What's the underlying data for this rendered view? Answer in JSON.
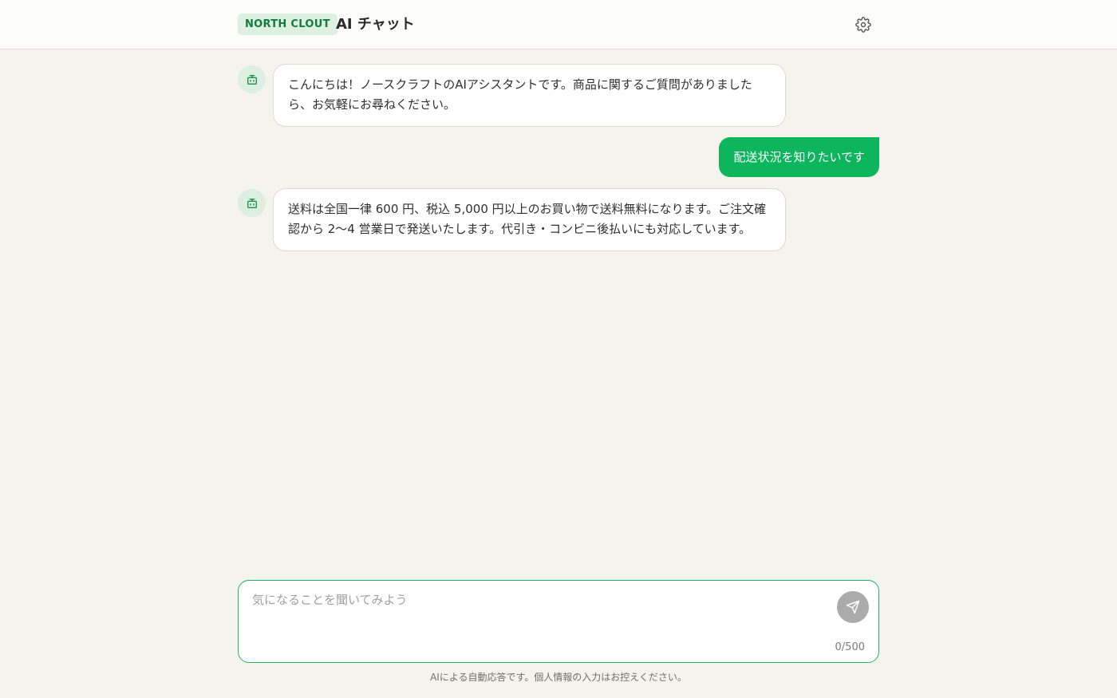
{
  "header": {
    "brand": "NORTH CLOUT",
    "title": "AI チャット",
    "settings_icon": "gear-icon"
  },
  "messages": [
    {
      "role": "assistant",
      "avatar_icon": "robot-icon",
      "text": "こんにちは！ノースクラフトのAIアシスタントです。商品に関するご質問がありましたら、お気軽にお尋ねください。"
    },
    {
      "role": "user",
      "text": "配送状況を知りたいです"
    },
    {
      "role": "assistant",
      "avatar_icon": "robot-icon",
      "text": "送料は全国一律 600 円、税込 5,000 円以上のお買い物で送料無料になります。ご注文確認から 2〜4 営業日で発送いたします。代引き・コンビニ後払いにも対応しています。"
    }
  ],
  "composer": {
    "value": "",
    "placeholder": "気になることを聞いてみよう",
    "char_count": "0/500",
    "send_icon": "send-icon"
  },
  "footer": {
    "disclaimer": "AIによる自動応答です。個人情報の入力はお控えください。"
  },
  "colors": {
    "accent": "#0db55d",
    "badge_bg": "#dcf1e2",
    "badge_text": "#157a3c",
    "background": "#f4f3ed"
  }
}
